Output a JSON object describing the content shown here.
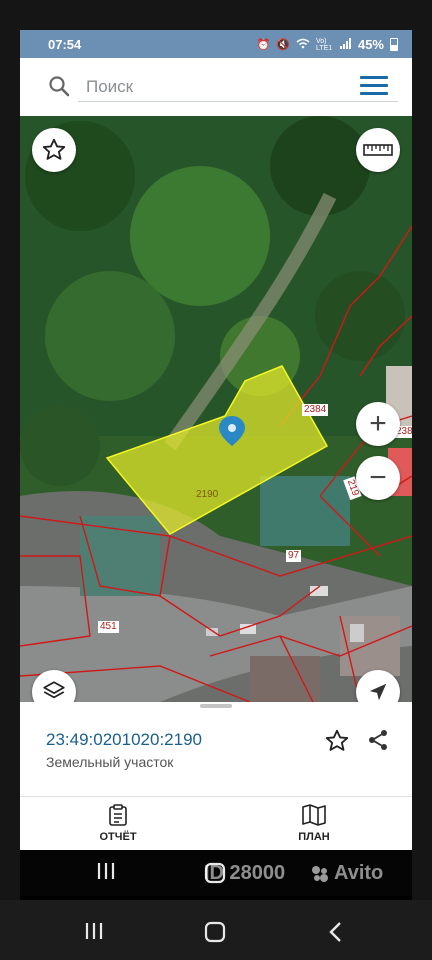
{
  "status_bar": {
    "time": "07:54",
    "battery": "45%",
    "network": "Vo) LTE1"
  },
  "search": {
    "placeholder": "Поиск"
  },
  "map": {
    "selected_parcel_label": "2190",
    "parcel_labels": [
      "2384",
      "238",
      "2190",
      "219",
      "97",
      "451",
      "85"
    ],
    "zoom_in_label": "+",
    "zoom_out_label": "−"
  },
  "info_panel": {
    "cadastral_number": "23:49:0201020:2190",
    "object_type": "Земельный участок"
  },
  "bottom_tabs": [
    {
      "label": "ОТЧЁТ"
    },
    {
      "label": "ПЛАН"
    }
  ],
  "watermark": {
    "brand": "Avito",
    "id_text": "ID 28000"
  },
  "colors": {
    "status_bar": "#6c8fb4",
    "accent": "#1b6aa5",
    "parcel_fill": "#e6ec2a",
    "boundary": "#d01818"
  }
}
